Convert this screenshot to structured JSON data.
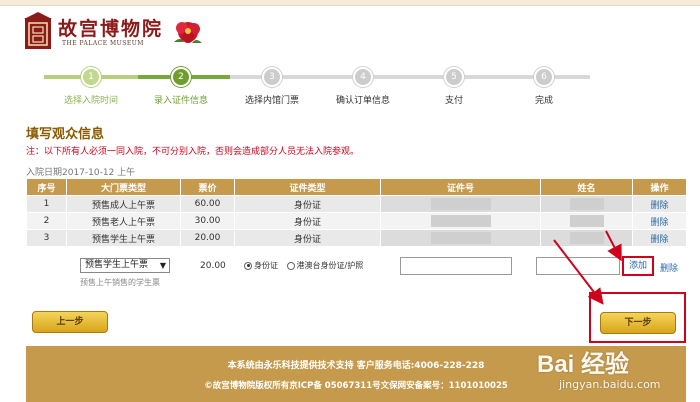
{
  "header": {
    "logo_title": "故宫博物院",
    "logo_subtitle": "THE PALACE MUSEUM"
  },
  "steps": [
    {
      "number": "1",
      "label": "选择入院时间",
      "state": "done"
    },
    {
      "number": "2",
      "label": "录入证件信息",
      "state": "active"
    },
    {
      "number": "3",
      "label": "选择内馆门票",
      "state": "todo"
    },
    {
      "number": "4",
      "label": "确认订单信息",
      "state": "todo"
    },
    {
      "number": "5",
      "label": "支付",
      "state": "todo"
    },
    {
      "number": "6",
      "label": "完成",
      "state": "todo"
    }
  ],
  "form": {
    "title": "填写观众信息",
    "notice": "注：以下所有人必须一同入院，不可分别入院，否则会造成部分人员无法入院参观。",
    "visit_date": "入院日期2017-10-12 上午"
  },
  "table": {
    "headers": [
      "序号",
      "大门票类型",
      "票价",
      "证件类型",
      "证件号",
      "姓名",
      "操作"
    ],
    "rows": [
      {
        "index": "1",
        "ticket_type": "预售成人上午票",
        "price": "60.00",
        "id_type": "身份证",
        "action": "删除"
      },
      {
        "index": "2",
        "ticket_type": "预售老人上午票",
        "price": "30.00",
        "id_type": "身份证",
        "action": "删除"
      },
      {
        "index": "3",
        "ticket_type": "预售学生上午票",
        "price": "20.00",
        "id_type": "身份证",
        "action": "删除"
      }
    ]
  },
  "add_row": {
    "selected_ticket": "预售学生上午票",
    "ticket_hint": "预售上午销售的学生票",
    "price": "20.00",
    "radio_id_card": "身份证",
    "radio_hk_macau": "港澳台身份证/护照",
    "add_label": "添加",
    "delete_label": "删除"
  },
  "buttons": {
    "prev": "上一步",
    "next": "下一步"
  },
  "footer": {
    "line1": "本系统由永乐科技提供技术支持 客户服务电话:4006-228-228",
    "line2": "©故宫博物院版权所有京ICP备 05067311号文保网安备案号：1101010025"
  },
  "watermark": {
    "logo": "Bai 经验",
    "url": "jingyan.baidu.com"
  },
  "colors": {
    "brand_gold": "#c59a4c",
    "step_active": "#6f9e2f",
    "notice_red": "#d0021b",
    "link_blue": "#2a6aaa"
  }
}
